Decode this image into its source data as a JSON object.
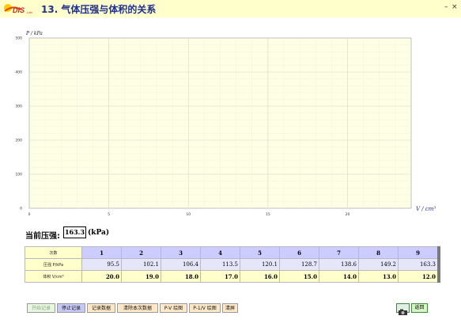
{
  "window": {
    "logo_text": "DIS",
    "logo_sub": "Lab",
    "title": "13. 气体压强与体积的关系",
    "minimize": "–",
    "close": "×"
  },
  "chart_data": {
    "type": "scatter",
    "ylabel": "P / kPa",
    "xlabel": "V / cm³",
    "ylim": [
      0,
      500
    ],
    "xlim": [
      0,
      24
    ],
    "y_ticks": [
      "0",
      "100",
      "200",
      "300",
      "400",
      "500"
    ],
    "x_ticks": [
      "0",
      "5",
      "10",
      "15",
      "20"
    ],
    "grid": true,
    "points": []
  },
  "readout": {
    "label": "当前压强:",
    "value": "163.3",
    "unit": "(kPa)"
  },
  "table": {
    "row_headers": [
      "次数",
      "压强 P/kPa",
      "体积 V/cm³"
    ],
    "columns": [
      "1",
      "2",
      "3",
      "4",
      "5",
      "6",
      "7",
      "8",
      "9"
    ],
    "pressure": [
      "95.5",
      "102.1",
      "106.4",
      "113.5",
      "120.1",
      "128.7",
      "138.6",
      "149.2",
      "163.3"
    ],
    "volume": [
      "20.0",
      "19.0",
      "18.0",
      "17.0",
      "16.0",
      "15.0",
      "14.0",
      "13.0",
      "12.0"
    ]
  },
  "toolbar": {
    "start": "开始记录",
    "stop": "停止记录",
    "record": "记录数据",
    "clear": "清除本次数据",
    "pv_plot": "P-V 绘图",
    "p1v_plot": "P-1/V 绘图",
    "clear_screen": "清屏",
    "back": "返回"
  },
  "colors": {
    "title_bar": "#ffffcc",
    "plot_bg": "#ffffe6",
    "header_col": "#ccccff",
    "pressure_row": "#e6e6fa",
    "volume_row": "#ffffcc"
  }
}
